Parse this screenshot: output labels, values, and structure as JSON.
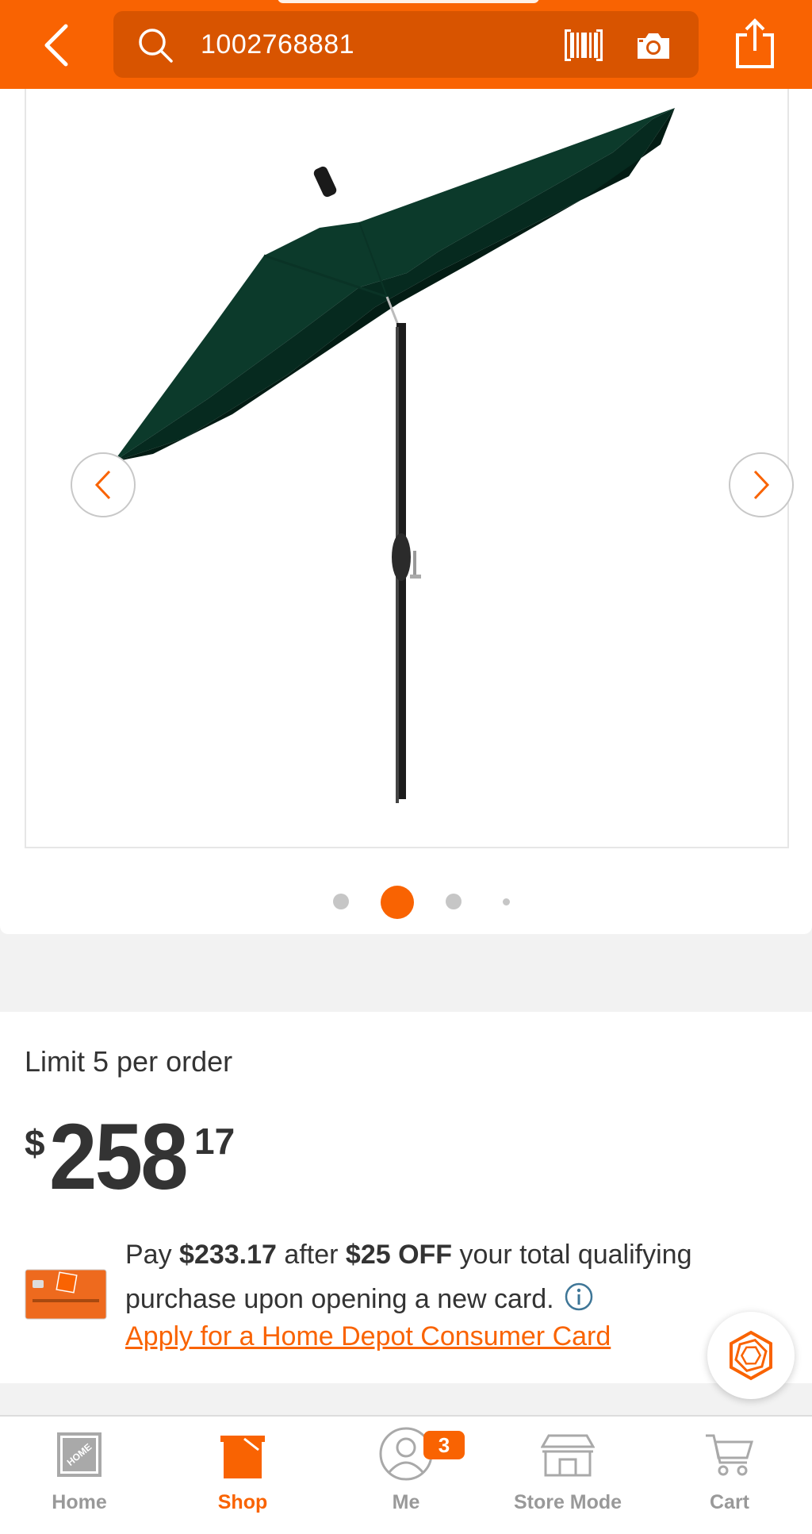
{
  "header": {
    "search_value": "1002768881",
    "back_icon": "chevron-left-icon",
    "search_icon": "search-icon",
    "barcode_icon": "barcode-icon",
    "camera_icon": "camera-icon",
    "share_icon": "share-icon",
    "brand_color": "#f96302"
  },
  "gallery": {
    "current_index": 2,
    "total_images": 4,
    "product_image": "green-patio-umbrella"
  },
  "pricing": {
    "limit_text": "Limit 5 per order",
    "currency_symbol": "$",
    "dollars": "258",
    "cents": "17"
  },
  "promo": {
    "pay_label": "Pay",
    "promo_price": "$233.17",
    "after_label": "after",
    "discount": "$25 OFF",
    "promo_rest": "your total qualifying purchase upon opening a new card.",
    "apply_link": "Apply for a Home Depot Consumer Card"
  },
  "bottom_nav": {
    "items": [
      {
        "label": "Home",
        "icon": "home-depot-logo-icon",
        "active": false
      },
      {
        "label": "Shop",
        "icon": "shop-bucket-icon",
        "active": true
      },
      {
        "label": "Me",
        "icon": "user-icon",
        "active": false,
        "badge": "3"
      },
      {
        "label": "Store Mode",
        "icon": "store-icon",
        "active": false
      },
      {
        "label": "Cart",
        "icon": "cart-icon",
        "active": false
      }
    ]
  }
}
